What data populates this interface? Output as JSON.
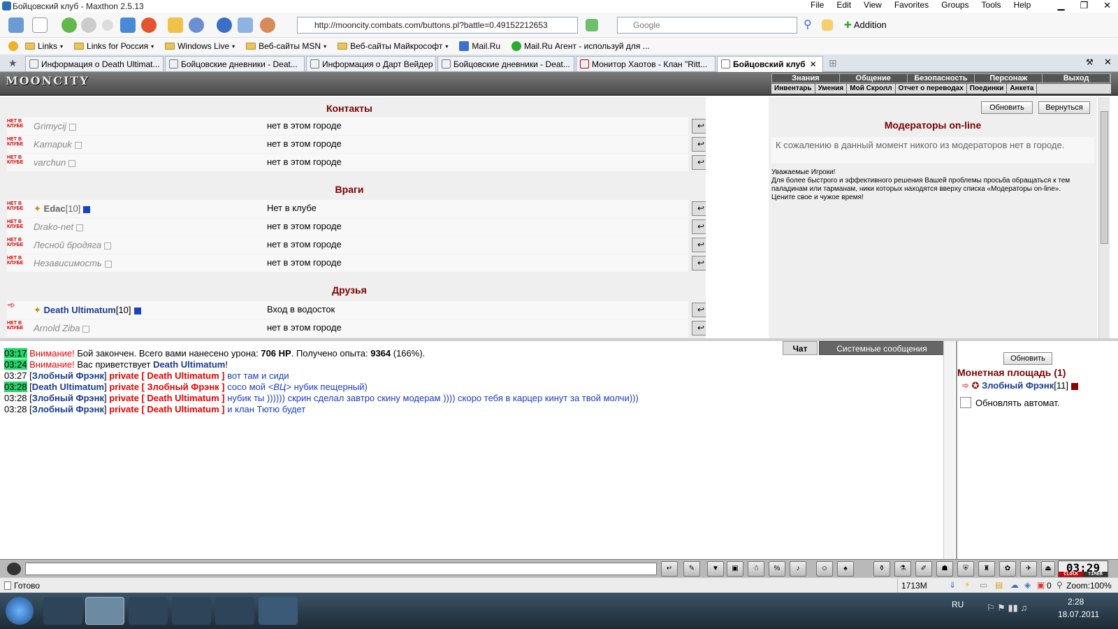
{
  "window": {
    "title": "Бойцовский клуб - Maxthon 2.5.13",
    "menu": [
      "File",
      "Edit",
      "View",
      "Favorites",
      "Groups",
      "Tools",
      "Help"
    ]
  },
  "toolbar": {
    "address": "http://mooncity.combats.com/buttons.pl?battle=0.49152212653",
    "search_placeholder": "Google",
    "addition_label": "Addition"
  },
  "bookmarks": [
    "Links",
    "Links for Россия",
    "Windows Live",
    "Веб-сайты MSN",
    "Веб-сайты Майкрософт",
    "Mail.Ru",
    "Mail.Ru Агент - используй для ..."
  ],
  "tabs": [
    {
      "label": "Информация о Death Ultimat...",
      "active": false
    },
    {
      "label": "Бойцовские дневники - Deat...",
      "active": false
    },
    {
      "label": "Информация о Дарт Вейдер",
      "active": false
    },
    {
      "label": "Бойцовские дневники - Deat...",
      "active": false
    },
    {
      "label": "Монитор Хаотов - Клан \"Ritt...",
      "active": false
    },
    {
      "label": "Бойцовский клуб",
      "active": true
    }
  ],
  "game": {
    "logo": "MOONCITY",
    "nav_top": [
      "Знания",
      "Общение",
      "Безопасность",
      "Персонаж",
      "Выход"
    ],
    "nav_bottom": [
      "Инвентарь",
      "Умения",
      "Мой Скролл",
      "Отчет о переводах",
      "Поединки",
      "Анкета"
    ]
  },
  "contacts": {
    "offline_badge": "НЕТ В КЛУБЕ",
    "sections": [
      {
        "title": "Контакты",
        "rows": [
          {
            "name": "Grimycij",
            "level": "",
            "location": "нет в этом городе",
            "online": false
          },
          {
            "name": "Kamapuk",
            "level": "",
            "location": "нет в этом городе",
            "online": false
          },
          {
            "name": "varchun",
            "level": "",
            "location": "нет в этом городе",
            "online": false
          }
        ]
      },
      {
        "title": "Враги",
        "rows": [
          {
            "name": "Edac",
            "level": "[10]",
            "location": "Нет в клубе",
            "online": true
          },
          {
            "name": "Drako-net",
            "level": "",
            "location": "нет в этом городе",
            "online": false
          },
          {
            "name": "Лесной бродяга",
            "level": "",
            "location": "нет в этом городе",
            "online": false
          },
          {
            "name": "Независимость",
            "level": "",
            "location": "нет в этом городе",
            "online": false
          }
        ]
      },
      {
        "title": "Друзья",
        "rows": [
          {
            "name": "Death Ultimatum",
            "level": "[10]",
            "location": "Вход в водосток",
            "online": true
          },
          {
            "name": "Arnold Ziba",
            "level": "",
            "location": "нет в этом городе",
            "online": false
          }
        ]
      }
    ]
  },
  "moderators": {
    "refresh_label": "Обновить",
    "back_label": "Вернуться",
    "title": "Модераторы on-line",
    "empty_text": "К сожалению в данный момент никого из модераторов нет в городе.",
    "note": "Уважаемые Игроки!\nДля более быстрого и эффективного решения Вашей проблемы просьба обращаться к тем паладинам или тарманам, ники которых находятся вверху списка «Модераторы on-line».\nЦените свое и чужое время!"
  },
  "chat": {
    "tab_chat": "Чат",
    "tab_system": "Системные сообщения",
    "lines": [
      {
        "time": "03:17",
        "highlight": true,
        "parts": [
          {
            "t": "Внимание!",
            "c": "warn"
          },
          {
            "t": " Бой закончен. Всего вами нанесено урона: ",
            "c": ""
          },
          {
            "t": "706 HP",
            "c": "bold"
          },
          {
            "t": ". Получено опыта: ",
            "c": ""
          },
          {
            "t": "9364",
            "c": "bold"
          },
          {
            "t": " (166%).",
            "c": ""
          }
        ]
      },
      {
        "time": "03:24",
        "highlight": true,
        "parts": [
          {
            "t": "Внимание!",
            "c": "warn"
          },
          {
            "t": " Вас приветствует ",
            "c": ""
          },
          {
            "t": "Death Ultimatum",
            "c": "nickb"
          },
          {
            "t": "!",
            "c": ""
          }
        ]
      },
      {
        "time": "03:27",
        "highlight": false,
        "parts": [
          {
            "t": "[",
            "c": ""
          },
          {
            "t": "Злобный Фрэнк",
            "c": "nickb"
          },
          {
            "t": "] ",
            "c": ""
          },
          {
            "t": "private [ Death Ultimatum ]",
            "c": "priv"
          },
          {
            "t": " вот там и сиди",
            "c": "msg"
          }
        ]
      },
      {
        "time": "03:28",
        "highlight": true,
        "parts": [
          {
            "t": "[",
            "c": ""
          },
          {
            "t": "Death Ultimatum",
            "c": "nickb"
          },
          {
            "t": "] ",
            "c": ""
          },
          {
            "t": "private [ Злобный Фрэнк ]",
            "c": "priv"
          },
          {
            "t": " сосо мой ",
            "c": "msg"
          },
          {
            "t": "<ВЦ>",
            "c": "msg ital"
          },
          {
            "t": " нубик пещерный)",
            "c": "msg"
          }
        ]
      },
      {
        "time": "03:28",
        "highlight": false,
        "parts": [
          {
            "t": "[",
            "c": ""
          },
          {
            "t": "Злобный Фрэнк",
            "c": "nickb"
          },
          {
            "t": "] ",
            "c": ""
          },
          {
            "t": "private [ Death Ultimatum ]",
            "c": "priv"
          },
          {
            "t": " нубик ты )))))) скрин сделал завтро скину модерам )))) скоро тебя в карцер кинут за твой молчи)))",
            "c": "msg"
          }
        ]
      },
      {
        "time": "03:28",
        "highlight": false,
        "parts": [
          {
            "t": "[",
            "c": ""
          },
          {
            "t": "Злобный Фрэнк",
            "c": "nickb"
          },
          {
            "t": "] ",
            "c": ""
          },
          {
            "t": "private [ Death Ultimatum ]",
            "c": "priv"
          },
          {
            "t": " и клан Тютю будет",
            "c": "msg"
          }
        ]
      }
    ]
  },
  "online_panel": {
    "refresh_label": "Обновить",
    "location_title": "Монетная площадь (1)",
    "user_name": "Злобный Фрэнк",
    "user_level": "[11]",
    "auto_refresh_label": "Обновлять автомат."
  },
  "game_clock": {
    "time": "03:29",
    "label_clock": "CLOCK",
    "label_timer": "TIMER"
  },
  "status_bar": {
    "status": "Готово",
    "memory": "1713M",
    "counter": "0",
    "zoom": "Zoom:100%"
  },
  "taskbar": {
    "lang": "RU",
    "time": "2:28",
    "date": "18.07.2011"
  },
  "colors": {
    "section_title": "#7a0000",
    "nick": "#1a3c8e",
    "private": "#e00000",
    "message": "#1a3cc6",
    "timestamp_hl": "#25d66c"
  }
}
